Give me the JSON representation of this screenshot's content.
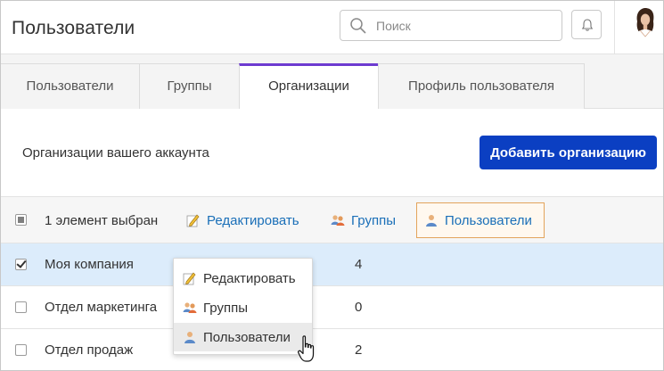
{
  "header": {
    "title": "Пользователи",
    "search_placeholder": "Поиск"
  },
  "tabs": [
    {
      "label": "Пользователи",
      "active": false
    },
    {
      "label": "Группы",
      "active": false
    },
    {
      "label": "Организации",
      "active": true
    },
    {
      "label": "Профиль пользователя",
      "active": false
    }
  ],
  "content": {
    "subtitle": "Организации вашего аккаунта",
    "add_button": "Добавить организацию"
  },
  "toolbar": {
    "selected_text": "1 элемент выбран",
    "edit": "Редактировать",
    "groups": "Группы",
    "users": "Пользователи"
  },
  "rows": [
    {
      "name": "Моя компания",
      "count": "4",
      "checked": true
    },
    {
      "name": "Отдел маркетинга",
      "count": "0",
      "checked": false
    },
    {
      "name": "Отдел продаж",
      "count": "2",
      "checked": false
    }
  ],
  "context_menu": {
    "edit": "Редактировать",
    "groups": "Группы",
    "users": "Пользователи"
  },
  "colors": {
    "accent_tab": "#6d3bd0",
    "primary_button": "#0b3fc2",
    "link": "#1a6fb8",
    "selected_row": "#dcecfb",
    "highlight_border": "#e3a45c"
  },
  "icons": [
    "search-icon",
    "bell-icon",
    "avatar",
    "pencil-icon",
    "group-icon",
    "user-icon",
    "hand-cursor-icon"
  ]
}
